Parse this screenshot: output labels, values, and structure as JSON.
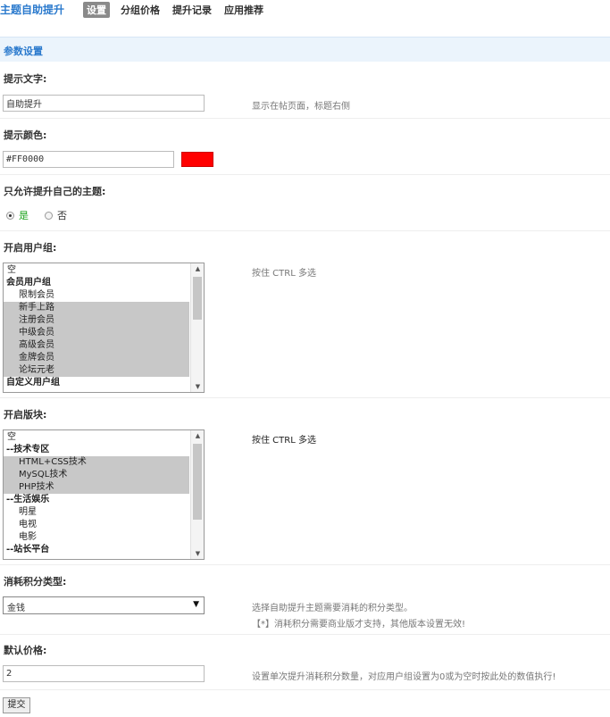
{
  "header": {
    "app_title": "主题自助提升",
    "tabs": [
      {
        "label": "设置",
        "active": true
      },
      {
        "label": "分组价格",
        "active": false
      },
      {
        "label": "提升记录",
        "active": false
      },
      {
        "label": "应用推荐",
        "active": false
      }
    ]
  },
  "section": {
    "title": "参数设置"
  },
  "fields": {
    "tip_text": {
      "label": "提示文字:",
      "value": "自助提升",
      "hint": "显示在帖页面，标题右侧"
    },
    "tip_color": {
      "label": "提示颜色:",
      "value": "#FF0000",
      "swatch_color": "#FF0000"
    },
    "own_only": {
      "label": "只允许提升自己的主题:",
      "yes": "是",
      "no": "否",
      "selected": "yes"
    },
    "user_groups": {
      "label": "开启用户组:",
      "hint": "按住 CTRL 多选",
      "items": [
        {
          "text": "空",
          "kind": "plain",
          "selected": false
        },
        {
          "text": "会员用户组",
          "kind": "group",
          "selected": false
        },
        {
          "text": "限制会员",
          "kind": "child",
          "selected": false
        },
        {
          "text": "新手上路",
          "kind": "child",
          "selected": true
        },
        {
          "text": "注册会员",
          "kind": "child",
          "selected": true
        },
        {
          "text": "中级会员",
          "kind": "child",
          "selected": true
        },
        {
          "text": "高级会员",
          "kind": "child",
          "selected": true
        },
        {
          "text": "金牌会员",
          "kind": "child",
          "selected": true
        },
        {
          "text": "论坛元老",
          "kind": "child",
          "selected": true
        },
        {
          "text": "自定义用户组",
          "kind": "group",
          "selected": false
        }
      ]
    },
    "boards": {
      "label": "开启版块:",
      "hint": "按住 CTRL 多选",
      "items": [
        {
          "text": "空",
          "kind": "plain",
          "selected": false
        },
        {
          "text": "--技术专区",
          "kind": "group",
          "selected": false
        },
        {
          "text": "HTML+CSS技术",
          "kind": "child",
          "selected": true
        },
        {
          "text": "MySQL技术",
          "kind": "child",
          "selected": true
        },
        {
          "text": "PHP技术",
          "kind": "child",
          "selected": true
        },
        {
          "text": "--生活娱乐",
          "kind": "group",
          "selected": false
        },
        {
          "text": "明星",
          "kind": "child",
          "selected": false
        },
        {
          "text": "电视",
          "kind": "child",
          "selected": false
        },
        {
          "text": "电影",
          "kind": "child",
          "selected": false
        },
        {
          "text": "--站长平台",
          "kind": "group",
          "selected": false
        }
      ]
    },
    "credit_type": {
      "label": "消耗积分类型:",
      "value": "金钱",
      "hint": "选择自助提升主题需要消耗的积分类型。",
      "hint2": "【*】消耗积分需要商业版才支持，其他版本设置无效!"
    },
    "default_price": {
      "label": "默认价格:",
      "value": "2",
      "hint": "设置单次提升消耗积分数量，对应用户组设置为0或为空时按此处的数值执行!"
    }
  },
  "submit_label": "提交"
}
